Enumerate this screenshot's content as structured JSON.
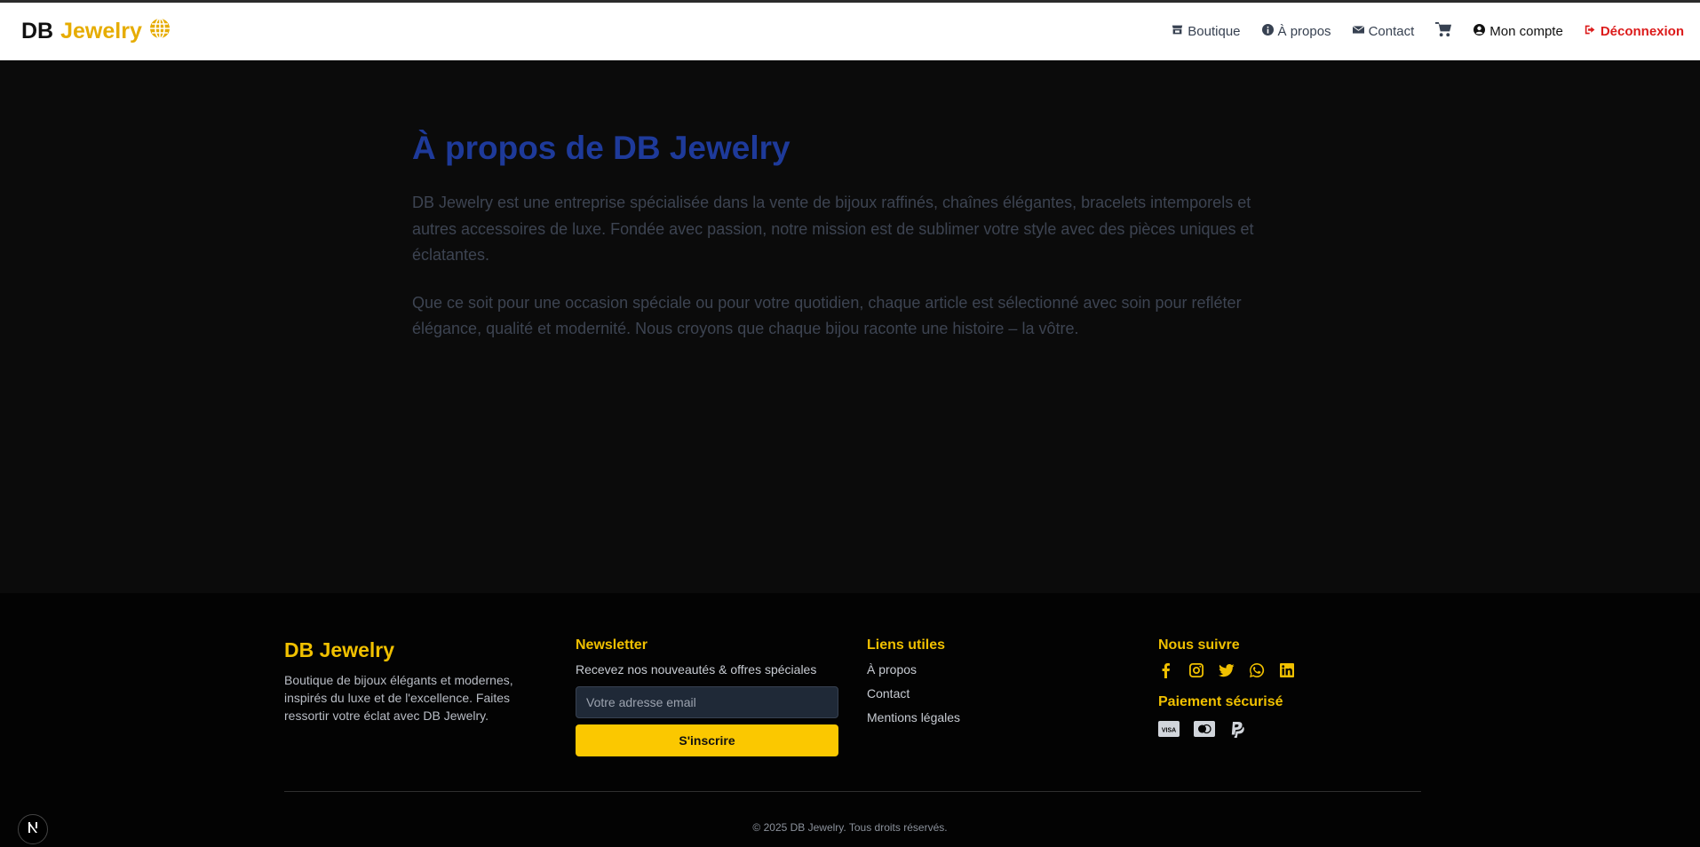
{
  "header": {
    "brand_db": "DB",
    "brand_jewelry": "Jewelry",
    "brand_icon": "globe-icon",
    "nav": {
      "shop": "Boutique",
      "about": "À propos",
      "contact": "Contact",
      "account": "Mon compte",
      "logout": "Déconnexion"
    }
  },
  "about": {
    "title": "À propos de DB Jewelry",
    "paragraph1": "DB Jewelry est une entreprise spécialisée dans la vente de bijoux raffinés, chaînes élégantes, bracelets intemporels et autres accessoires de luxe. Fondée avec passion, notre mission est de sublimer votre style avec des pièces uniques et éclatantes.",
    "paragraph2": "Que ce soit pour une occasion spéciale ou pour votre quotidien, chaque article est sélectionné avec soin pour refléter élégance, qualité et modernité. Nous croyons que chaque bijou raconte une histoire – la vôtre."
  },
  "footer": {
    "brand": "DB Jewelry",
    "description": "Boutique de bijoux élégants et modernes, inspirés du luxe et de l'excellence. Faites ressortir votre éclat avec DB Jewelry.",
    "newsletter": {
      "title": "Newsletter",
      "text": "Recevez nos nouveautés & offres spéciales",
      "placeholder": "Votre adresse email",
      "button": "S'inscrire"
    },
    "links": {
      "title": "Liens utiles",
      "about": "À propos",
      "contact": "Contact",
      "legal": "Mentions légales"
    },
    "follow": {
      "title": "Nous suivre",
      "icons": [
        "facebook-icon",
        "instagram-icon",
        "twitter-icon",
        "whatsapp-icon",
        "linkedin-icon"
      ]
    },
    "payment": {
      "title": "Paiement sécurisé",
      "icons": [
        "visa-icon",
        "mastercard-icon",
        "paypal-icon"
      ]
    },
    "copyright": "© 2025 DB Jewelry. Tous droits réservés."
  },
  "colors": {
    "accent": "#f0c000",
    "title_blue": "#1e3a9a",
    "logout_red": "#dc1b1b"
  }
}
